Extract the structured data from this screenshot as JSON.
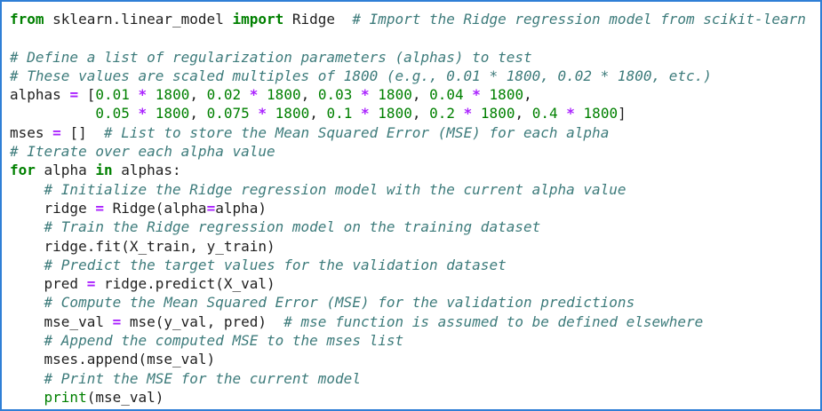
{
  "colors": {
    "border": "#2f7fd6",
    "keyword": "#008000",
    "comment": "#3d7b7b",
    "number": "#008000",
    "operator": "#aa22ff",
    "text": "#1f1f1f",
    "background": "#ffffff"
  },
  "code": {
    "lines": [
      [
        {
          "t": "kw",
          "v": "from"
        },
        {
          "t": "tx",
          "v": " sklearn.linear_model "
        },
        {
          "t": "kw",
          "v": "import"
        },
        {
          "t": "tx",
          "v": " Ridge  "
        },
        {
          "t": "cm",
          "v": "# Import the Ridge regression model from scikit-learn"
        }
      ],
      [],
      [
        {
          "t": "cm",
          "v": "# Define a list of regularization parameters (alphas) to test"
        }
      ],
      [
        {
          "t": "cm",
          "v": "# These values are scaled multiples of 1800 (e.g., 0.01 * 1800, 0.02 * 1800, etc.)"
        }
      ],
      [
        {
          "t": "tx",
          "v": "alphas "
        },
        {
          "t": "op",
          "v": "="
        },
        {
          "t": "tx",
          "v": " ["
        },
        {
          "t": "num",
          "v": "0.01"
        },
        {
          "t": "tx",
          "v": " "
        },
        {
          "t": "op",
          "v": "*"
        },
        {
          "t": "tx",
          "v": " "
        },
        {
          "t": "num",
          "v": "1800"
        },
        {
          "t": "tx",
          "v": ", "
        },
        {
          "t": "num",
          "v": "0.02"
        },
        {
          "t": "tx",
          "v": " "
        },
        {
          "t": "op",
          "v": "*"
        },
        {
          "t": "tx",
          "v": " "
        },
        {
          "t": "num",
          "v": "1800"
        },
        {
          "t": "tx",
          "v": ", "
        },
        {
          "t": "num",
          "v": "0.03"
        },
        {
          "t": "tx",
          "v": " "
        },
        {
          "t": "op",
          "v": "*"
        },
        {
          "t": "tx",
          "v": " "
        },
        {
          "t": "num",
          "v": "1800"
        },
        {
          "t": "tx",
          "v": ", "
        },
        {
          "t": "num",
          "v": "0.04"
        },
        {
          "t": "tx",
          "v": " "
        },
        {
          "t": "op",
          "v": "*"
        },
        {
          "t": "tx",
          "v": " "
        },
        {
          "t": "num",
          "v": "1800"
        },
        {
          "t": "tx",
          "v": ","
        }
      ],
      [
        {
          "t": "tx",
          "v": "          "
        },
        {
          "t": "num",
          "v": "0.05"
        },
        {
          "t": "tx",
          "v": " "
        },
        {
          "t": "op",
          "v": "*"
        },
        {
          "t": "tx",
          "v": " "
        },
        {
          "t": "num",
          "v": "1800"
        },
        {
          "t": "tx",
          "v": ", "
        },
        {
          "t": "num",
          "v": "0.075"
        },
        {
          "t": "tx",
          "v": " "
        },
        {
          "t": "op",
          "v": "*"
        },
        {
          "t": "tx",
          "v": " "
        },
        {
          "t": "num",
          "v": "1800"
        },
        {
          "t": "tx",
          "v": ", "
        },
        {
          "t": "num",
          "v": "0.1"
        },
        {
          "t": "tx",
          "v": " "
        },
        {
          "t": "op",
          "v": "*"
        },
        {
          "t": "tx",
          "v": " "
        },
        {
          "t": "num",
          "v": "1800"
        },
        {
          "t": "tx",
          "v": ", "
        },
        {
          "t": "num",
          "v": "0.2"
        },
        {
          "t": "tx",
          "v": " "
        },
        {
          "t": "op",
          "v": "*"
        },
        {
          "t": "tx",
          "v": " "
        },
        {
          "t": "num",
          "v": "1800"
        },
        {
          "t": "tx",
          "v": ", "
        },
        {
          "t": "num",
          "v": "0.4"
        },
        {
          "t": "tx",
          "v": " "
        },
        {
          "t": "op",
          "v": "*"
        },
        {
          "t": "tx",
          "v": " "
        },
        {
          "t": "num",
          "v": "1800"
        },
        {
          "t": "tx",
          "v": "]"
        }
      ],
      [
        {
          "t": "tx",
          "v": "mses "
        },
        {
          "t": "op",
          "v": "="
        },
        {
          "t": "tx",
          "v": " []  "
        },
        {
          "t": "cm",
          "v": "# List to store the Mean Squared Error (MSE) for each alpha"
        }
      ],
      [
        {
          "t": "cm",
          "v": "# Iterate over each alpha value"
        }
      ],
      [
        {
          "t": "kw",
          "v": "for"
        },
        {
          "t": "tx",
          "v": " alpha "
        },
        {
          "t": "kw",
          "v": "in"
        },
        {
          "t": "tx",
          "v": " alphas:"
        }
      ],
      [
        {
          "t": "tx",
          "v": "    "
        },
        {
          "t": "cm",
          "v": "# Initialize the Ridge regression model with the current alpha value"
        }
      ],
      [
        {
          "t": "tx",
          "v": "    ridge "
        },
        {
          "t": "op",
          "v": "="
        },
        {
          "t": "tx",
          "v": " Ridge(alpha"
        },
        {
          "t": "op",
          "v": "="
        },
        {
          "t": "tx",
          "v": "alpha)"
        }
      ],
      [
        {
          "t": "tx",
          "v": "    "
        },
        {
          "t": "cm",
          "v": "# Train the Ridge regression model on the training dataset"
        }
      ],
      [
        {
          "t": "tx",
          "v": "    ridge"
        },
        {
          "t": "tx",
          "v": ".fit(X_train, y_train)"
        }
      ],
      [
        {
          "t": "tx",
          "v": "    "
        },
        {
          "t": "cm",
          "v": "# Predict the target values for the validation dataset"
        }
      ],
      [
        {
          "t": "tx",
          "v": "    pred "
        },
        {
          "t": "op",
          "v": "="
        },
        {
          "t": "tx",
          "v": " ridge.predict(X_val)"
        }
      ],
      [
        {
          "t": "tx",
          "v": "    "
        },
        {
          "t": "cm",
          "v": "# Compute the Mean Squared Error (MSE) for the validation predictions"
        }
      ],
      [
        {
          "t": "tx",
          "v": "    mse_val "
        },
        {
          "t": "op",
          "v": "="
        },
        {
          "t": "tx",
          "v": " mse(y_val, pred)  "
        },
        {
          "t": "cm",
          "v": "# mse function is assumed to be defined elsewhere"
        }
      ],
      [
        {
          "t": "tx",
          "v": "    "
        },
        {
          "t": "cm",
          "v": "# Append the computed MSE to the mses list"
        }
      ],
      [
        {
          "t": "tx",
          "v": "    mses.append(mse_val)"
        }
      ],
      [
        {
          "t": "tx",
          "v": "    "
        },
        {
          "t": "cm",
          "v": "# Print the MSE for the current model"
        }
      ],
      [
        {
          "t": "tx",
          "v": "    "
        },
        {
          "t": "bi",
          "v": "print"
        },
        {
          "t": "tx",
          "v": "(mse_val)"
        }
      ]
    ]
  }
}
